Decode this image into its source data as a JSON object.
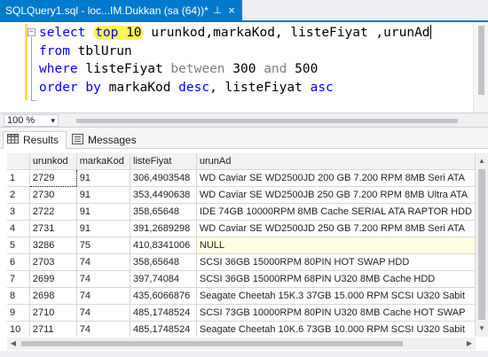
{
  "tab": {
    "title": "SQLQuery1.sql - loc...IM.Dukkan (sa (64))*",
    "pin_glyph": "⊥",
    "close_glyph": "×"
  },
  "editor": {
    "line1": {
      "kw1": "select",
      "kw2": "top",
      "num": "10",
      "rest": " urunkod,markaKod, listeFiyat ,urunAd"
    },
    "line2": {
      "kw": "from",
      "rest": " tblUrun"
    },
    "line3": {
      "kw": "where",
      "id": " listeFiyat ",
      "between": "between",
      "v1": " 300 ",
      "and": "and",
      "v2": " 500"
    },
    "line4": {
      "kw1": "order",
      "kw2": "by",
      "id": " markaKod ",
      "kw3": "desc",
      "mid": ", listeFiyat ",
      "kw4": "asc"
    }
  },
  "zoom": {
    "value": "100 %"
  },
  "results_tabs": [
    {
      "label": "Results",
      "icon": "grid-icon"
    },
    {
      "label": "Messages",
      "icon": "messages-icon"
    }
  ],
  "grid": {
    "columns": [
      "urunkod",
      "markaKod",
      "listeFiyat",
      "urunAd"
    ],
    "rows": [
      [
        "1",
        "2729",
        "91",
        "306,4903548",
        "WD Caviar SE WD2500JD 200 GB 7.200 RPM 8MB Seri ATA"
      ],
      [
        "2",
        "2730",
        "91",
        "353,4490638",
        "WD Caviar SE WD2500JB 250 GB 7.200 RPM 8MB Ultra ATA"
      ],
      [
        "3",
        "2722",
        "91",
        "358,65648",
        "IDE 74GB 10000RPM 8MB Cache SERIAL ATA RAPTOR HDD"
      ],
      [
        "4",
        "2731",
        "91",
        "391,2689298",
        "WD Caviar SE WD2500JD 250 GB 7.200 RPM 8MB Seri ATA"
      ],
      [
        "5",
        "3286",
        "75",
        "410,8341006",
        "NULL"
      ],
      [
        "6",
        "2703",
        "74",
        "358,65648",
        "SCSI 36GB 15000RPM 80PIN HOT SWAP HDD"
      ],
      [
        "7",
        "2699",
        "74",
        "397,74084",
        "SCSI 36GB 15000RPM 68PIN U320 8MB Cache HDD"
      ],
      [
        "8",
        "2698",
        "74",
        "435,6066876",
        "Seagate Cheetah 15K.3 37GB 15.000 RPM SCSI U320 Sabit"
      ],
      [
        "9",
        "2710",
        "74",
        "485,1748524",
        "SCSI 73GB 10000RPM 80PIN U320 8MB Cache HOT SWAP"
      ],
      [
        "10",
        "2711",
        "74",
        "485,1748524",
        "Seagate Cheetah 10K.6 73GB 10.000 RPM SCSI U320 Sabit"
      ]
    ]
  },
  "colors": {
    "accent": "#007acc",
    "keyword": "#0000ff",
    "highlight": "#fff35c",
    "null_cell": "#ffffe1"
  }
}
